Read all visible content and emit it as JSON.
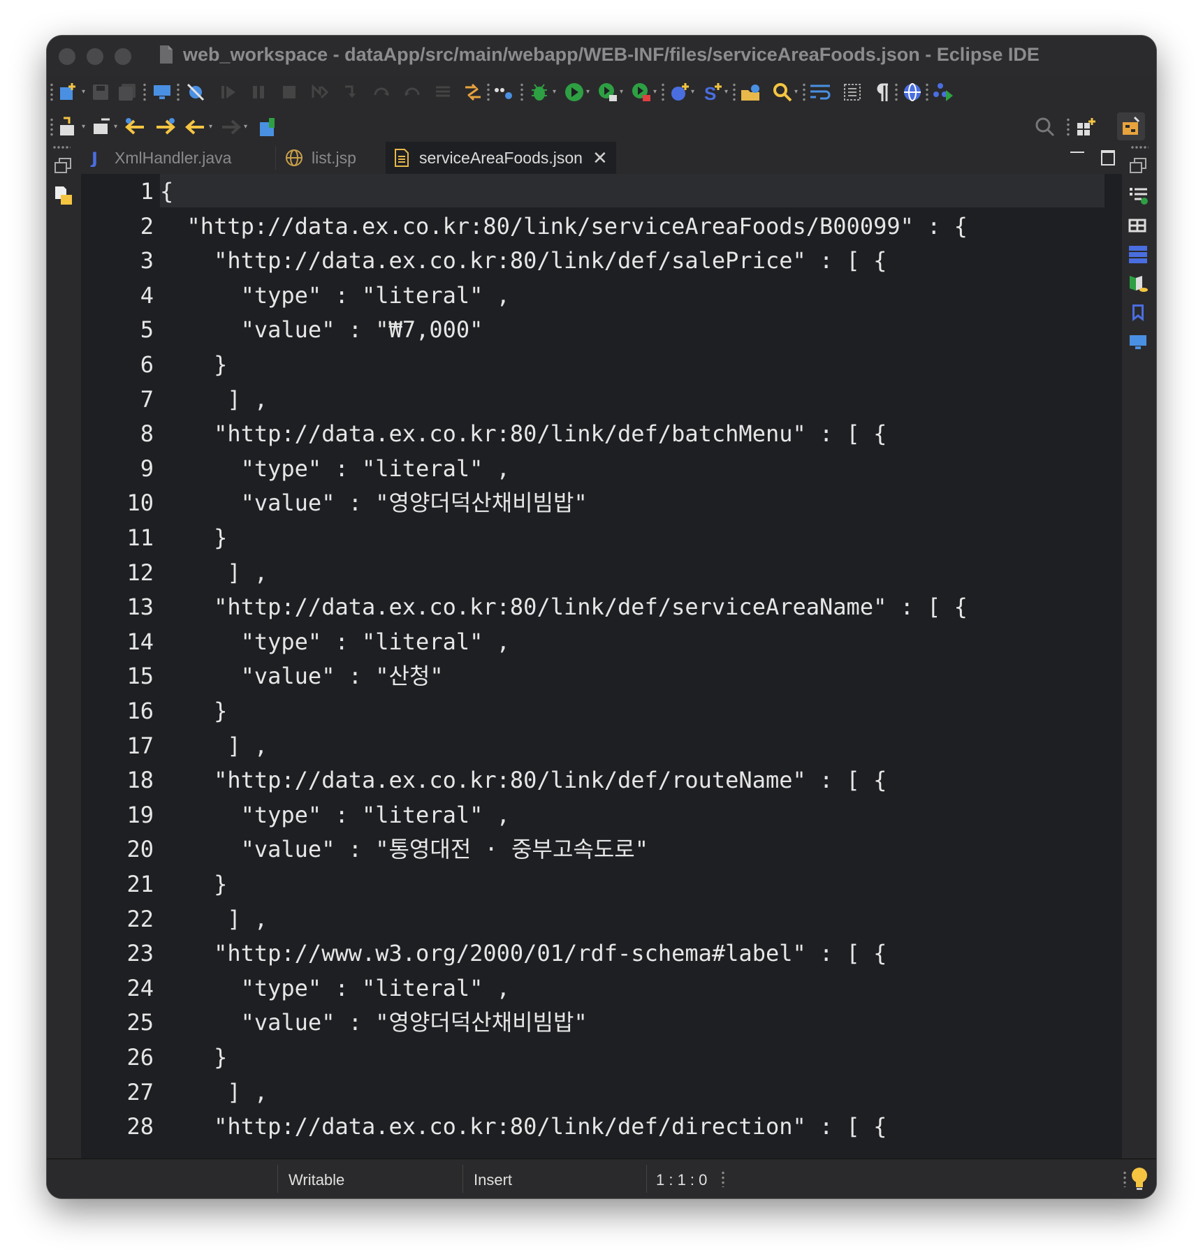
{
  "window": {
    "title": "web_workspace - dataApp/src/main/webapp/WEB-INF/files/serviceAreaFoods.json - Eclipse IDE"
  },
  "toolbar": {
    "row1_icons": [
      "new-icon",
      "save-icon",
      "save-all-icon",
      "monitor-icon",
      "skip-breakpoints-icon",
      "resume-icon",
      "suspend-icon",
      "terminate-icon",
      "disconnect-icon",
      "step-into-icon",
      "step-over-icon",
      "step-return-icon",
      "drop-to-frame-icon",
      "toggle-ant-icon",
      "pipeline-icon",
      "debug-icon",
      "run-icon",
      "run-last-icon",
      "coverage-icon",
      "new-server-icon",
      "new-class-icon",
      "open-type-icon",
      "search-icon",
      "word-wrap-icon",
      "block-select-icon",
      "show-whitespace-icon",
      "web-browser-icon",
      "deploy-icon"
    ],
    "row2_icons": [
      "import-icon",
      "export-icon",
      "prev-annotation-icon",
      "next-edit-icon",
      "back-icon",
      "forward-icon",
      "pin-editor-icon"
    ],
    "search_icon": "search-icon",
    "open_perspective_icon": "open-perspective-icon",
    "java_ee_perspective_icon": "java-ee-perspective-icon"
  },
  "tabs": [
    {
      "label": "XmlHandler.java",
      "icon": "java-file-icon",
      "active": false
    },
    {
      "label": "list.jsp",
      "icon": "globe-file-icon",
      "active": false
    },
    {
      "label": "serviceAreaFoods.json",
      "icon": "text-file-icon",
      "active": true
    }
  ],
  "editor": {
    "lines": [
      {
        "n": "1",
        "text": "{"
      },
      {
        "n": "2",
        "text": "  \"http://data.ex.co.kr:80/link/serviceAreaFoods/B00099\" : {"
      },
      {
        "n": "3",
        "text": "    \"http://data.ex.co.kr:80/link/def/salePrice\" : [ {"
      },
      {
        "n": "4",
        "text": "      \"type\" : \"literal\" ,"
      },
      {
        "n": "5",
        "text": "      \"value\" : \"₩7,000\""
      },
      {
        "n": "6",
        "text": "    }"
      },
      {
        "n": "7",
        "text": "     ] ,"
      },
      {
        "n": "8",
        "text": "    \"http://data.ex.co.kr:80/link/def/batchMenu\" : [ {"
      },
      {
        "n": "9",
        "text": "      \"type\" : \"literal\" ,"
      },
      {
        "n": "10",
        "text": "      \"value\" : \"영양더덕산채비빔밥\""
      },
      {
        "n": "11",
        "text": "    }"
      },
      {
        "n": "12",
        "text": "     ] ,"
      },
      {
        "n": "13",
        "text": "    \"http://data.ex.co.kr:80/link/def/serviceAreaName\" : [ {"
      },
      {
        "n": "14",
        "text": "      \"type\" : \"literal\" ,"
      },
      {
        "n": "15",
        "text": "      \"value\" : \"산청\""
      },
      {
        "n": "16",
        "text": "    }"
      },
      {
        "n": "17",
        "text": "     ] ,"
      },
      {
        "n": "18",
        "text": "    \"http://data.ex.co.kr:80/link/def/routeName\" : [ {"
      },
      {
        "n": "19",
        "text": "      \"type\" : \"literal\" ,"
      },
      {
        "n": "20",
        "text": "      \"value\" : \"통영대전 · 중부고속도로\""
      },
      {
        "n": "21",
        "text": "    }"
      },
      {
        "n": "22",
        "text": "     ] ,"
      },
      {
        "n": "23",
        "text": "    \"http://www.w3.org/2000/01/rdf-schema#label\" : [ {"
      },
      {
        "n": "24",
        "text": "      \"type\" : \"literal\" ,"
      },
      {
        "n": "25",
        "text": "      \"value\" : \"영양더덕산채비빔밥\""
      },
      {
        "n": "26",
        "text": "    }"
      },
      {
        "n": "27",
        "text": "     ] ,"
      },
      {
        "n": "28",
        "text": "    \"http://data.ex.co.kr:80/link/def/direction\" : [ {"
      }
    ]
  },
  "status": {
    "writable": "Writable",
    "insert_mode": "Insert",
    "position": "1 : 1 : 0"
  },
  "colors": {
    "editor_bg": "#1e1f22",
    "chrome_bg": "#2a2a2c",
    "text": "#e6e6e6",
    "accent_blue": "#4a90e2",
    "accent_green": "#2ea043"
  }
}
